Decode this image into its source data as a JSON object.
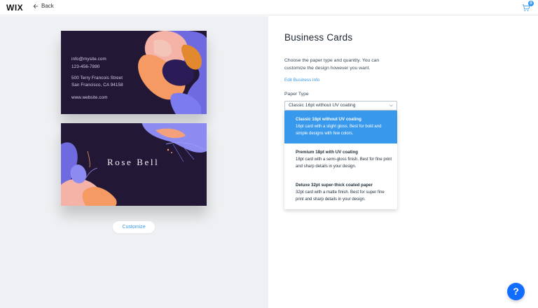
{
  "header": {
    "logo": "WIX",
    "back_label": "Back",
    "cart_count": "0"
  },
  "preview": {
    "front": {
      "email": "info@mysite.com",
      "phone": "123-456-7890",
      "address_line1": "500 Terry Francois Street",
      "address_line2": "San Francisco, CA 94158",
      "website": "www.website.com"
    },
    "back": {
      "name": "Rose Bell"
    },
    "customize_label": "Customize"
  },
  "panel": {
    "title": "Business Cards",
    "description": "Choose the paper type and quantity. You can customize the design however you want.",
    "edit_link": "Edit Business Info",
    "paper_type_label": "Paper Type",
    "paper_type_value": "Classic 16pt without UV coating",
    "options": [
      {
        "title": "Classic 16pt without UV coating",
        "description": "16pt card with a slight gloss. Best for bold and simple designs with few colors.",
        "selected": true
      },
      {
        "title": "Premium 18pt with UV coating",
        "description": "18pt card with a semi-gloss finish. Best for fine print and sharp details in your design.",
        "selected": false
      },
      {
        "title": "Deluxe 32pt super-thick coated paper",
        "description": "32pt card with a matte finish. Best for super fine print and sharp details in your design.",
        "selected": false
      }
    ]
  },
  "help": {
    "label": "?"
  },
  "colors": {
    "accent": "#3899ec",
    "card_background": "#221735",
    "help_button": "#116dff",
    "preview_background": "#eef0f3"
  }
}
